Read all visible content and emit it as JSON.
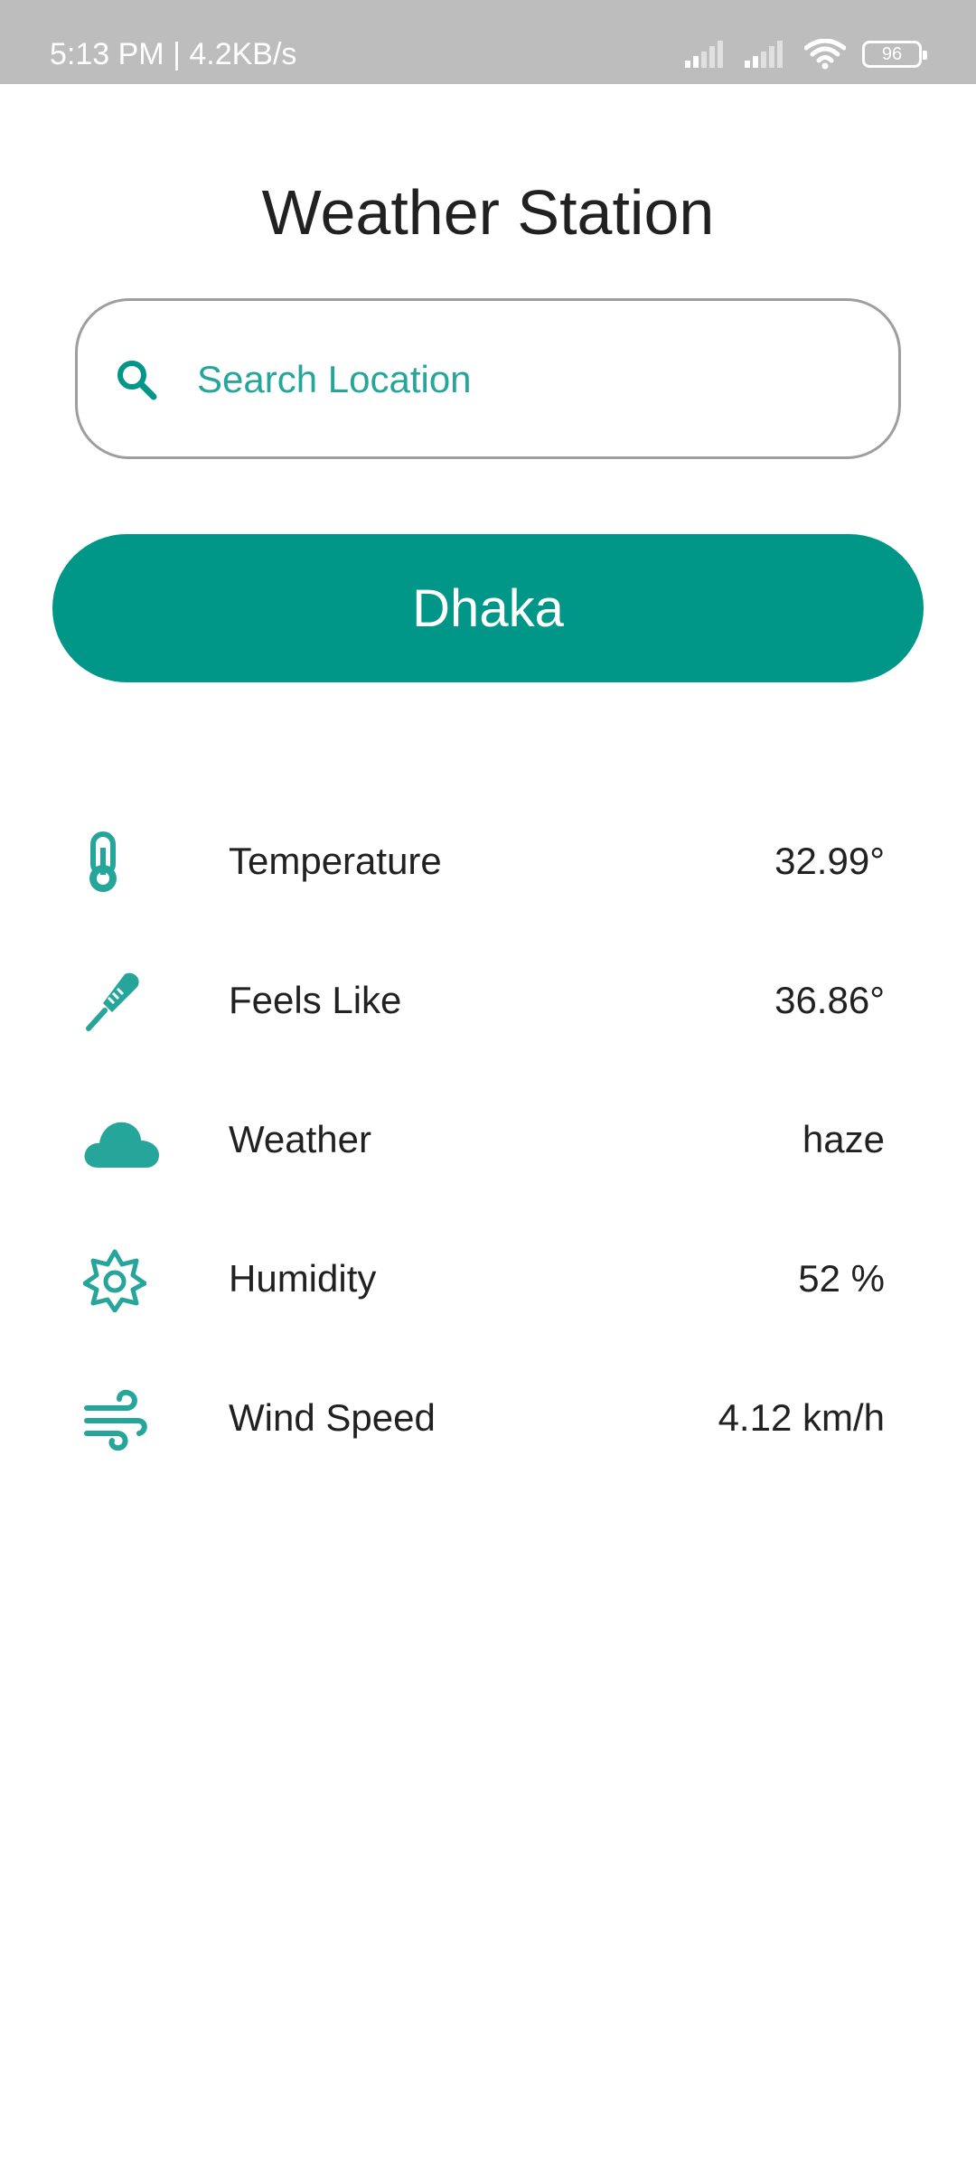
{
  "status_bar": {
    "time_speed": "5:13 PM | 4.2KB/s",
    "battery": "96"
  },
  "app": {
    "title": "Weather Station"
  },
  "search": {
    "placeholder": "Search Location",
    "value": ""
  },
  "city_button": {
    "label": "Dhaka"
  },
  "weather": {
    "rows": [
      {
        "icon": "thermometer-icon",
        "label": "Temperature",
        "value": "32.99°"
      },
      {
        "icon": "feels-like-thermometer-icon",
        "label": "Feels Like",
        "value": "36.86°"
      },
      {
        "icon": "cloud-icon",
        "label": "Weather",
        "value": "haze"
      },
      {
        "icon": "humidity-sun-icon",
        "label": "Humidity",
        "value": "52 %"
      },
      {
        "icon": "wind-icon",
        "label": "Wind Speed",
        "value": "4.12 km/h"
      }
    ]
  },
  "colors": {
    "accent": "#009688",
    "accent_light": "#26a69a",
    "status_bar": "#bdbdbd",
    "text": "#212121"
  }
}
